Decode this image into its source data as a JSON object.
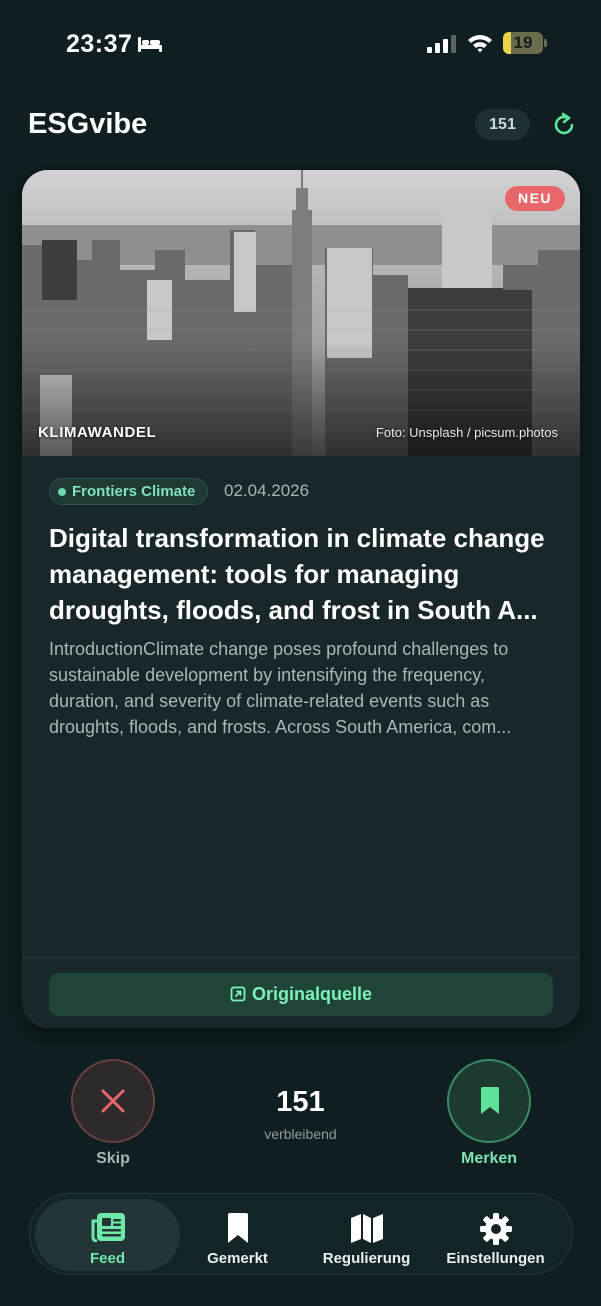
{
  "status_bar": {
    "time": "23:37",
    "battery_level": "19",
    "battery_fraction": 0.19,
    "icons": [
      "bed-icon",
      "cellular-signal-icon",
      "wifi-icon",
      "battery-icon"
    ]
  },
  "header": {
    "title": "ESGvibe",
    "count": "151",
    "refresh_icon": "refresh-icon"
  },
  "card": {
    "badge": "NEU",
    "category": "KLIMAWANDEL",
    "photo_credit": "Foto: Unsplash / picsum.photos",
    "source": "Frontiers Climate",
    "date": "02.04.2026",
    "title": "Digital transformation in climate change management: tools for managing droughts, floods, and frost in South A...",
    "excerpt": "IntroductionClimate change poses profound challenges to sustainable development by intensifying the frequency, duration, and severity of climate-related events such as droughts, floods, and frosts. Across South America, com...",
    "original_source_label": "Originalquelle"
  },
  "actions": {
    "skip_label": "Skip",
    "remaining_count": "151",
    "remaining_label": "verbleibend",
    "save_label": "Merken"
  },
  "tabs": [
    {
      "label": "Feed",
      "icon": "newspaper-icon",
      "active": true
    },
    {
      "label": "Gemerkt",
      "icon": "bookmark-icon",
      "active": false
    },
    {
      "label": "Regulierung",
      "icon": "map-icon",
      "active": false
    },
    {
      "label": "Einstellungen",
      "icon": "gear-icon",
      "active": false
    }
  ],
  "colors": {
    "background": "#0f1e20",
    "card": "#18282a",
    "accent_green": "#6ee9a8",
    "badge_red": "#e8676a",
    "skip_red": "#e8676a"
  }
}
